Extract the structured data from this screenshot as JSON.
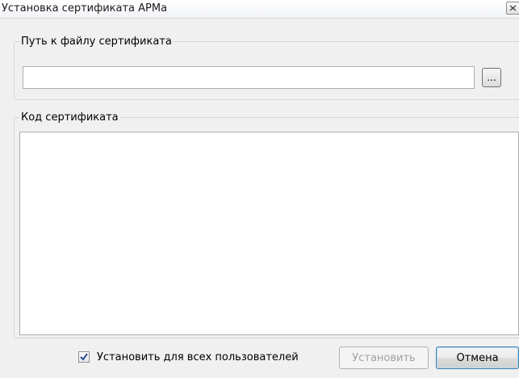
{
  "window": {
    "title": "Установка сертификата АРМа",
    "close_icon": "close-icon"
  },
  "path_group": {
    "legend": "Путь к файлу сертификата",
    "input_value": "",
    "browse_label": "..."
  },
  "code_group": {
    "legend": "Код сертификата",
    "value": ""
  },
  "footer": {
    "all_users_label": "Установить для всех пользователей",
    "all_users_checked": true,
    "install_label": "Установить",
    "install_enabled": false,
    "cancel_label": "Отмена"
  },
  "colors": {
    "check_mark": "#2a4b8d",
    "default_button_border": "#3c7fb1"
  }
}
